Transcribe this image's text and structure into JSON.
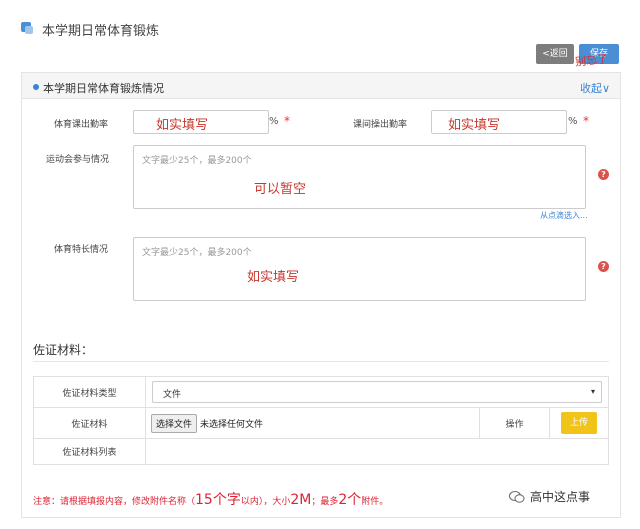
{
  "page": {
    "title": "本学期日常体育锻炼"
  },
  "toolbar": {
    "back_label": "<返回",
    "save_label": "保存",
    "save_overlay": "别忘了"
  },
  "card": {
    "title": "本学期日常体育锻炼情况",
    "collapse_label": "收起∨",
    "fields": {
      "pe_rate_label": "体育课出勤率",
      "pe_rate_handwritten": "如实填写",
      "break_rate_label": "课间操出勤率",
      "break_rate_handwritten": "如实填写",
      "percent_sign": "%",
      "required_mark": "*",
      "sports_meet_label": "运动会参与情况",
      "sports_meet_placeholder": "文字最少25个，最多200个",
      "sports_meet_handwritten": "可以暂空",
      "pick_link": "从点滴选入...",
      "specialty_label": "体育特长情况",
      "specialty_placeholder": "文字最少25个，最多200个",
      "specialty_handwritten": "如实填写",
      "help_glyph": "?"
    },
    "evidence": {
      "title": "佐证材料：",
      "type_label": "佐证材料类型",
      "type_value": "文件",
      "type_caret": "▾",
      "material_label": "佐证材料",
      "choose_file": "选择文件",
      "no_file": "未选择任何文件",
      "ops_label": "操作",
      "upload_label": "上传",
      "list_label": "佐证材料列表"
    },
    "note": {
      "p1": "注意：请根据填报内容，修改附件名称（",
      "big1": "15个字",
      "p2": "以内），大小",
      "big2": "2M",
      "p3": "；最多",
      "big3": "2个",
      "p4": "附件。"
    }
  },
  "watermark": "高中这点事",
  "colors": {
    "accent": "#3a84d5",
    "handwriting": "#c8372d",
    "upload": "#f0c419",
    "back": "#7d7d7d"
  }
}
